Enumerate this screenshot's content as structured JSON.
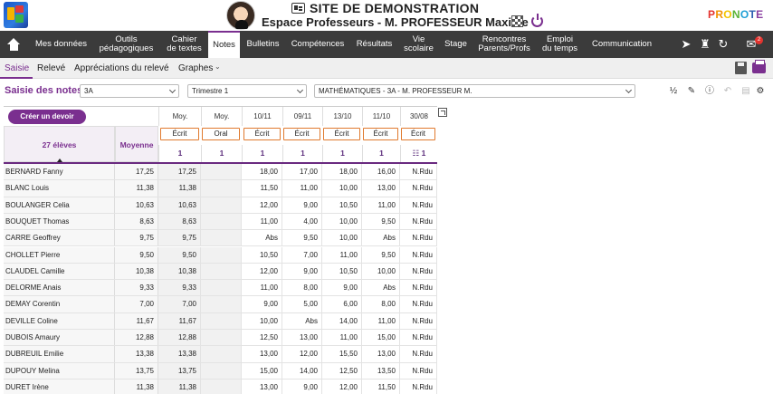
{
  "header": {
    "site_title": "SITE DE DEMONSTRATION",
    "subtitle": "Espace Professeurs - M. PROFESSEUR Maxime",
    "brand": [
      "P",
      "R",
      "O",
      "N",
      "O",
      "T",
      "E"
    ]
  },
  "nav": {
    "items": [
      {
        "label": "Mes données"
      },
      {
        "label": "Outils\npédagogiques"
      },
      {
        "label": "Cahier\nde textes"
      },
      {
        "label": "Notes"
      },
      {
        "label": "Bulletins"
      },
      {
        "label": "Compétences"
      },
      {
        "label": "Résultats"
      },
      {
        "label": "Vie\nscolaire"
      },
      {
        "label": "Stage"
      },
      {
        "label": "Rencontres\nParents/Profs"
      },
      {
        "label": "Emploi\ndu temps"
      },
      {
        "label": "Communication"
      }
    ],
    "active": "Notes",
    "notification_count": "2"
  },
  "tabs": {
    "items": [
      "Saisie",
      "Relevé",
      "Appréciations du relevé",
      "Graphes"
    ],
    "active": "Saisie"
  },
  "filters": {
    "title": "Saisie des notes",
    "classe": "3A",
    "periode": "Trimestre 1",
    "service": "MATHÉMATIQUES - 3A - M. PROFESSEUR M."
  },
  "grid": {
    "create_button": "Créer un devoir",
    "students_header": "27 élèves",
    "average_header": "Moyenne",
    "columns": [
      {
        "top": "Moy.",
        "type": "Écrit",
        "coef": "1"
      },
      {
        "top": "Moy.",
        "type": "Oral",
        "coef": "1"
      },
      {
        "top": "10/11",
        "type": "Écrit",
        "coef": "1"
      },
      {
        "top": "09/11",
        "type": "Écrit",
        "coef": "1"
      },
      {
        "top": "13/10",
        "type": "Écrit",
        "coef": "1"
      },
      {
        "top": "11/10",
        "type": "Écrit",
        "coef": "1"
      },
      {
        "top": "30/08",
        "type": "Écrit",
        "coef": "1"
      }
    ],
    "rows": [
      {
        "name": "BERNARD Fanny",
        "avg": "17,25",
        "cells": [
          "17,25",
          "",
          "18,00",
          "17,00",
          "18,00",
          "16,00",
          "N.Rdu"
        ]
      },
      {
        "name": "BLANC Louis",
        "avg": "11,38",
        "cells": [
          "11,38",
          "",
          "11,50",
          "11,00",
          "10,00",
          "13,00",
          "N.Rdu"
        ]
      },
      {
        "name": "BOULANGER Celia",
        "avg": "10,63",
        "cells": [
          "10,63",
          "",
          "12,00",
          "9,00",
          "10,50",
          "11,00",
          "N.Rdu"
        ]
      },
      {
        "name": "BOUQUET Thomas",
        "avg": "8,63",
        "cells": [
          "8,63",
          "",
          "11,00",
          "4,00",
          "10,00",
          "9,50",
          "N.Rdu"
        ]
      },
      {
        "name": "CARRE Geoffrey",
        "avg": "9,75",
        "cells": [
          "9,75",
          "",
          "Abs",
          "9,50",
          "10,00",
          "Abs",
          "N.Rdu"
        ]
      },
      {
        "name": "CHOLLET Pierre",
        "avg": "9,50",
        "cells": [
          "9,50",
          "",
          "10,50",
          "7,00",
          "11,00",
          "9,50",
          "N.Rdu"
        ]
      },
      {
        "name": "CLAUDEL Camille",
        "avg": "10,38",
        "cells": [
          "10,38",
          "",
          "12,00",
          "9,00",
          "10,50",
          "10,00",
          "N.Rdu"
        ]
      },
      {
        "name": "DELORME Anais",
        "avg": "9,33",
        "cells": [
          "9,33",
          "",
          "11,00",
          "8,00",
          "9,00",
          "Abs",
          "N.Rdu"
        ]
      },
      {
        "name": "DEMAY Corentin",
        "avg": "7,00",
        "cells": [
          "7,00",
          "",
          "9,00",
          "5,00",
          "6,00",
          "8,00",
          "N.Rdu"
        ]
      },
      {
        "name": "DEVILLE Coline",
        "avg": "11,67",
        "cells": [
          "11,67",
          "",
          "10,00",
          "Abs",
          "14,00",
          "11,00",
          "N.Rdu"
        ]
      },
      {
        "name": "DUBOIS Amaury",
        "avg": "12,88",
        "cells": [
          "12,88",
          "",
          "12,50",
          "13,00",
          "11,00",
          "15,00",
          "N.Rdu"
        ]
      },
      {
        "name": "DUBREUIL Emilie",
        "avg": "13,38",
        "cells": [
          "13,38",
          "",
          "13,00",
          "12,00",
          "15,50",
          "13,00",
          "N.Rdu"
        ]
      },
      {
        "name": "DUPOUY Melina",
        "avg": "13,75",
        "cells": [
          "13,75",
          "",
          "15,00",
          "14,00",
          "12,50",
          "13,50",
          "N.Rdu"
        ]
      },
      {
        "name": "DURET Irène",
        "avg": "11,38",
        "cells": [
          "11,38",
          "",
          "13,00",
          "9,00",
          "12,00",
          "11,50",
          "N.Rdu"
        ]
      }
    ]
  },
  "colors": {
    "accent": "#7a2f8f",
    "nav_bg": "#3b3b3b",
    "type_border": "#e07a2e"
  }
}
